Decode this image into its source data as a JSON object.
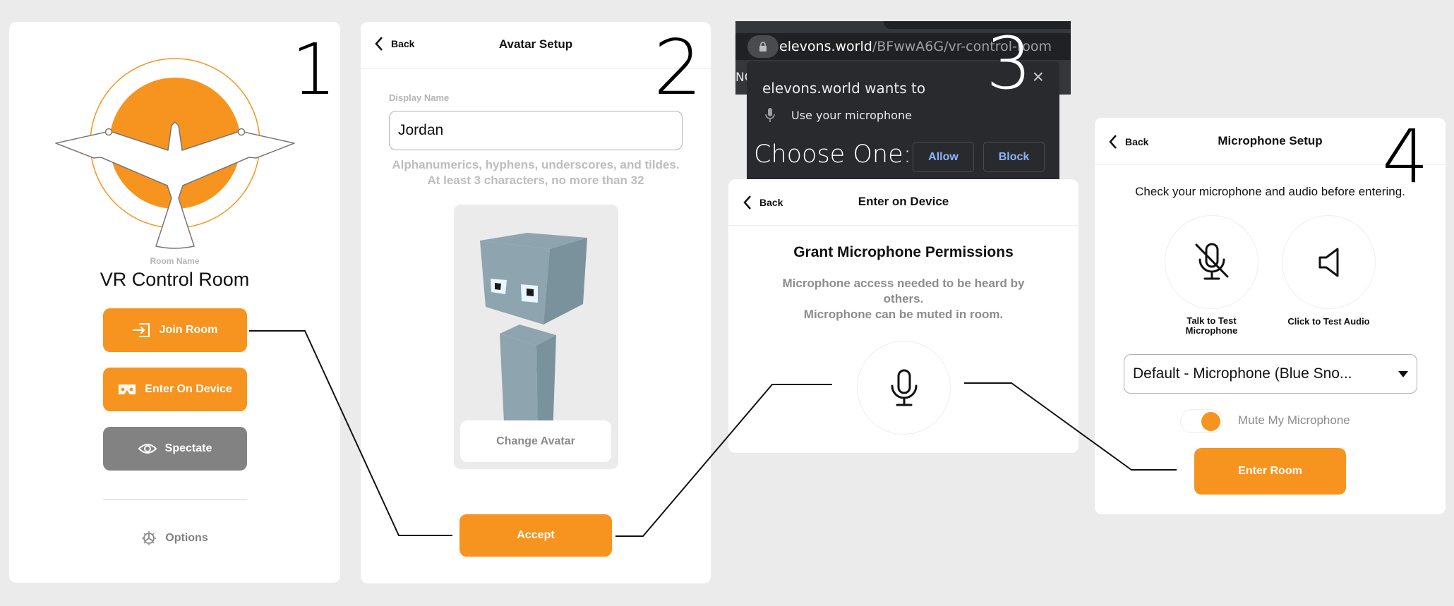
{
  "theme": {
    "accent": "#f7941f",
    "spectate_grey": "#828282",
    "page_bg": "#ebebeb",
    "browser_dark": "#202124",
    "link_blue": "#8ab4f8"
  },
  "step1": {
    "number": "1",
    "logo_icon": "bird-sun-logo",
    "room_name_label": "Room Name",
    "room_name": "VR Control Room",
    "buttons": [
      {
        "label": "Join Room",
        "icon": "enter-icon"
      },
      {
        "label": "Enter On Device",
        "icon": "vr-headset-icon"
      },
      {
        "label": "Spectate",
        "icon": "eye-icon"
      }
    ],
    "options_label": "Options"
  },
  "step2": {
    "number": "2",
    "back_label": "Back",
    "title": "Avatar Setup",
    "display_name_label": "Display Name",
    "display_name_value": "Jordan",
    "hint": "Alphanumerics, hyphens, underscores, and tildes. At least 3 characters, no more than 32",
    "change_avatar_label": "Change Avatar",
    "accept_label": "Accept"
  },
  "step3": {
    "number": "3",
    "browser": {
      "url_domain": "elevons.world",
      "url_path": "/BFwwA6G/vr-control-room",
      "tab_fragment": "NC",
      "prompt_title": "elevons.world wants to",
      "permission": "Use your microphone",
      "choose_label": "Choose One:",
      "allow_label": "Allow",
      "block_label": "Block",
      "close_symbol": "×"
    },
    "back_label": "Back",
    "title": "Enter on Device",
    "heading": "Grant Microphone Permissions",
    "desc_line1": "Microphone access needed to be heard by others.",
    "desc_line2": "Microphone can be muted in room."
  },
  "step4": {
    "number": "4",
    "back_label": "Back",
    "title": "Microphone Setup",
    "instructions": "Check your microphone and audio before entering.",
    "test_mic_label": "Talk to Test Microphone",
    "test_audio_label": "Click to Test Audio",
    "mic_select_value": "Default - Microphone (Blue Sno...",
    "mute_label": "Mute My Microphone",
    "mute_on": true,
    "enter_room_label": "Enter Room"
  }
}
